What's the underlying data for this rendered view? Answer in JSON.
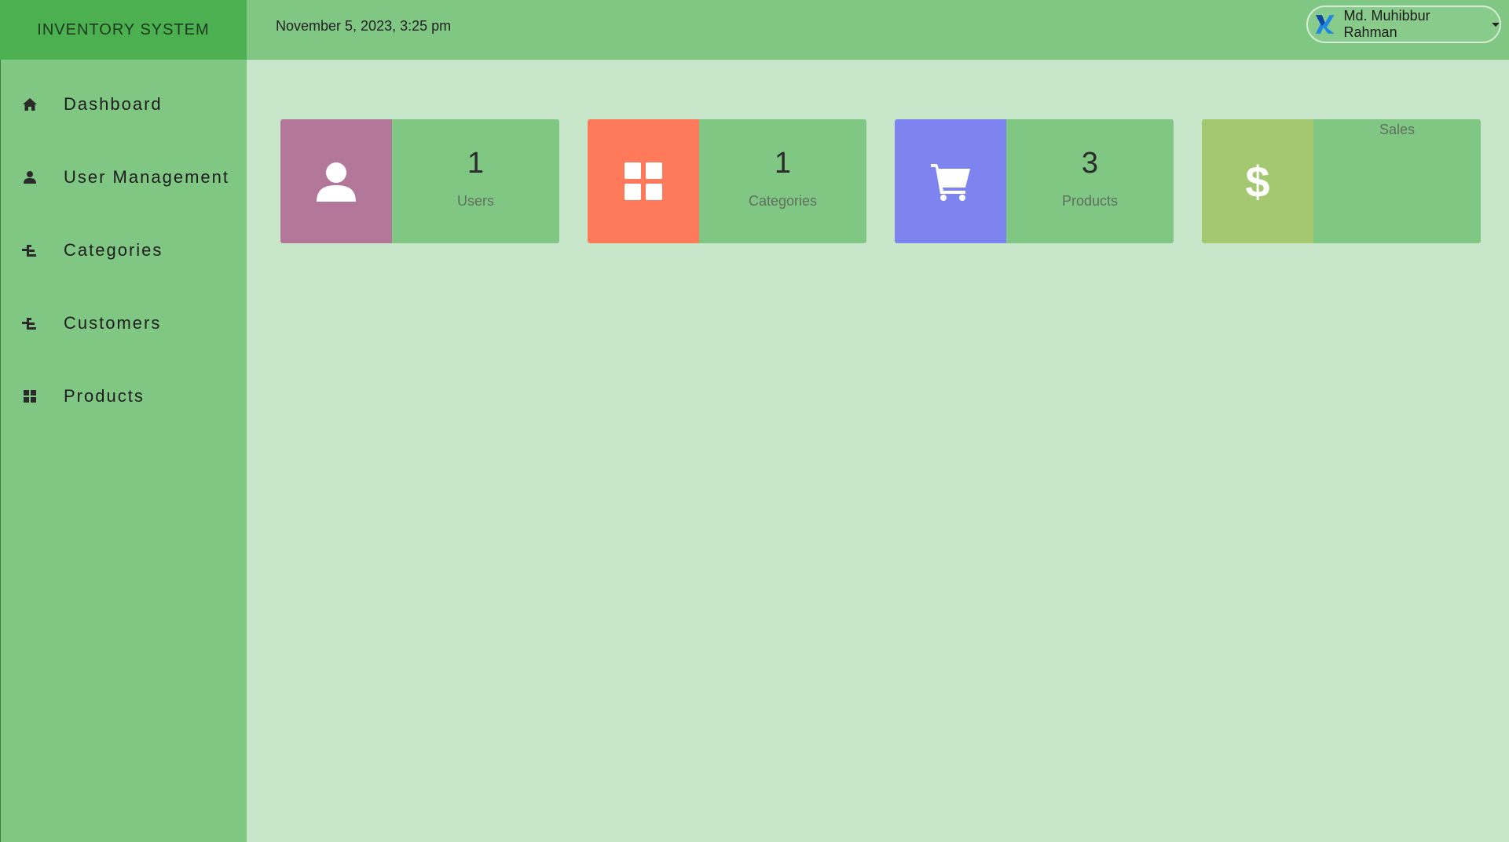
{
  "app": {
    "title": "INVENTORY SYSTEM"
  },
  "header": {
    "datetime": "November 5, 2023, 3:25 pm",
    "user_name": "Md. Muhibbur Rahman"
  },
  "sidebar": {
    "items": [
      {
        "label": "Dashboard",
        "icon": "home-icon"
      },
      {
        "label": "User Management",
        "icon": "user-icon"
      },
      {
        "label": "Categories",
        "icon": "sitemap-icon"
      },
      {
        "label": "Customers",
        "icon": "sitemap-icon"
      },
      {
        "label": "Products",
        "icon": "grid-icon"
      }
    ]
  },
  "cards": [
    {
      "value": "1",
      "label": "Users",
      "icon": "user-icon",
      "color": "#b27799"
    },
    {
      "value": "1",
      "label": "Categories",
      "icon": "grid-icon",
      "color": "#ff7a5a"
    },
    {
      "value": "3",
      "label": "Products",
      "icon": "cart-icon",
      "color": "#7d84f0"
    },
    {
      "value": "",
      "label": "Sales",
      "icon": "dollar-icon",
      "color": "#a4c870"
    }
  ],
  "colors": {
    "brand": "#4caf50",
    "topbar": "#81c784",
    "sidebar": "#81c784",
    "content_bg": "#c8e6c9",
    "card_info": "#81c784"
  }
}
